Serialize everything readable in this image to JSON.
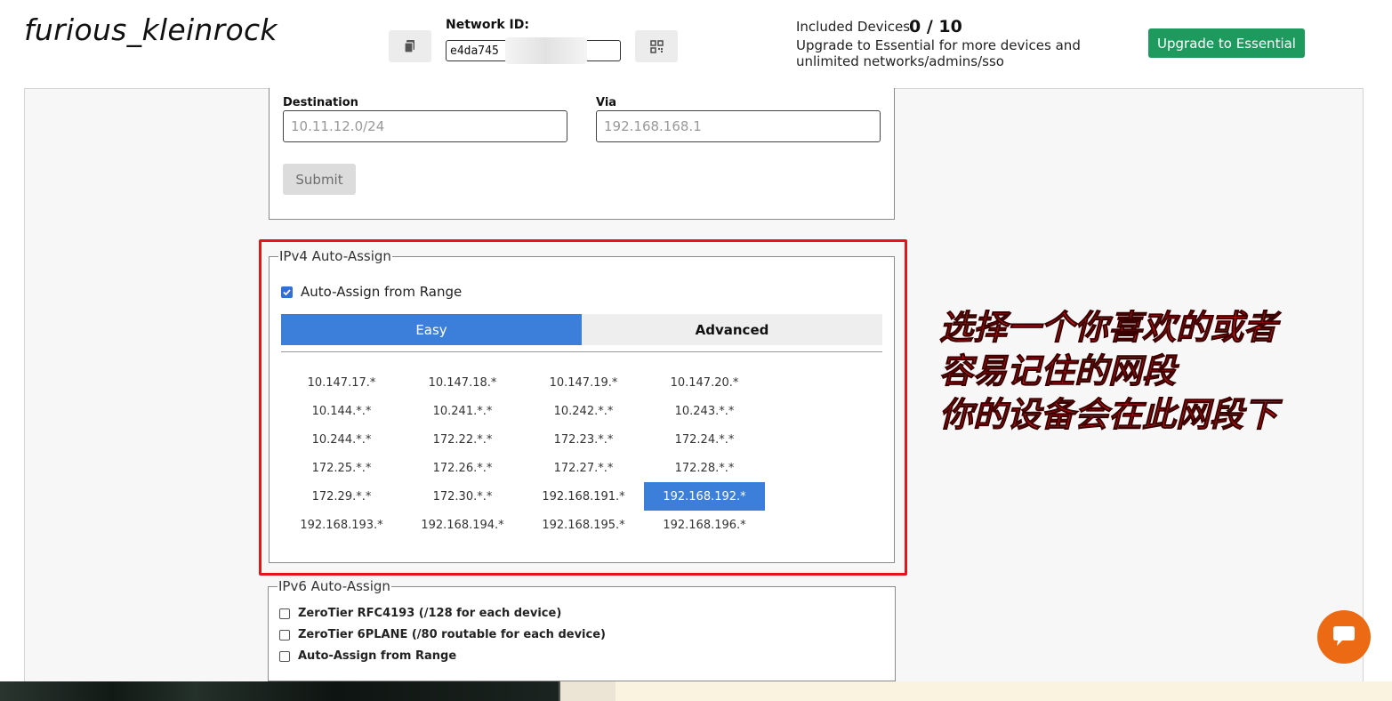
{
  "header": {
    "network_name": "furious_kleinrock",
    "network_id_label": "Network ID:",
    "network_id_value": "e4da745",
    "copy_icon": "copy-icon",
    "qr_icon": "qr-code-icon",
    "devices_label": "Included Devices:",
    "devices_count": "0 / 10",
    "upgrade_text": "Upgrade to Essential for more devices and unlimited networks/admins/sso",
    "upgrade_button": "Upgrade to Essential",
    "upgrade_color": "#1f9a5e"
  },
  "routes": {
    "destination_label": "Destination",
    "destination_placeholder": "10.11.12.0/24",
    "via_label": "Via",
    "via_placeholder": "192.168.168.1",
    "submit_label": "Submit"
  },
  "ipv4": {
    "legend": "IPv4 Auto-Assign",
    "auto_assign_label": "Auto-Assign from Range",
    "auto_assign_checked": true,
    "tab_easy": "Easy",
    "tab_advanced": "Advanced",
    "active_tab": "Easy",
    "selected_range": "192.168.192.*",
    "accent_color": "#3c7fdb",
    "ranges": [
      [
        "10.147.17.*",
        "10.147.18.*",
        "10.147.19.*",
        "10.147.20.*"
      ],
      [
        "10.144.*.*",
        "10.241.*.*",
        "10.242.*.*",
        "10.243.*.*"
      ],
      [
        "10.244.*.*",
        "172.22.*.*",
        "172.23.*.*",
        "172.24.*.*"
      ],
      [
        "172.25.*.*",
        "172.26.*.*",
        "172.27.*.*",
        "172.28.*.*"
      ],
      [
        "172.29.*.*",
        "172.30.*.*",
        "192.168.191.*",
        "192.168.192.*"
      ],
      [
        "192.168.193.*",
        "192.168.194.*",
        "192.168.195.*",
        "192.168.196.*"
      ]
    ]
  },
  "ipv6": {
    "legend": "IPv6 Auto-Assign",
    "options": [
      {
        "label": "ZeroTier RFC4193 (/128 for each device)",
        "checked": false
      },
      {
        "label": "ZeroTier 6PLANE (/80 routable for each device)",
        "checked": false
      },
      {
        "label": "Auto-Assign from Range",
        "checked": false
      }
    ]
  },
  "annotation": {
    "lines": [
      "选择一个你喜欢的或者",
      "容易记住的网段",
      "你的设备会在此网段下"
    ],
    "color": "#e01414"
  },
  "chat": {
    "icon": "chat-icon",
    "color": "#ec6a13"
  }
}
